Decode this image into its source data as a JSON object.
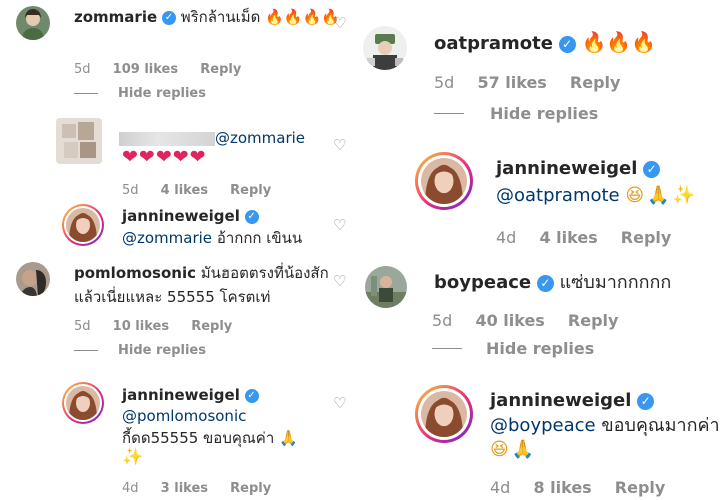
{
  "left": {
    "c1": {
      "user": "zommarie",
      "text": "พริกล้านเม็ด",
      "emoji": "🔥🔥🔥🔥",
      "age": "5d",
      "likes": "109 likes",
      "reply": "Reply",
      "hide": "Hide replies"
    },
    "c2": {
      "mention": "@zommarie",
      "emoji": "❤❤❤❤❤",
      "age": "5d",
      "likes": "4 likes",
      "reply": "Reply"
    },
    "c3": {
      "user": "jannineweigel",
      "mention": "@zommarie",
      "text": "อ้ากกก เขินน"
    },
    "c4": {
      "user": "pomlomosonic",
      "text1": "มันฮอตตรงที่น้องสัก",
      "text2": "แล้วเนี่ยแหละ 55555 โครตเท่",
      "age": "5d",
      "likes": "10 likes",
      "reply": "Reply",
      "hide": "Hide replies"
    },
    "c5": {
      "user": "jannineweigel",
      "mention": "@pomlomosonic",
      "text": "กี้ดด55555 ขอบคุณค่า",
      "emoji1": "🙏",
      "emoji2": "✨",
      "age": "4d",
      "likes": "3 likes",
      "reply": "Reply"
    }
  },
  "right": {
    "c1": {
      "user": "oatpramote",
      "emoji": "🔥🔥🔥",
      "age": "5d",
      "likes": "57 likes",
      "reply": "Reply",
      "hide": "Hide replies"
    },
    "c2": {
      "user": "jannineweigel",
      "mention": "@oatpramote",
      "emoji": "😆🙏✨",
      "age": "4d",
      "likes": "4 likes",
      "reply": "Reply"
    },
    "c3": {
      "user": "boypeace",
      "text": "แซ่บมากกกกก",
      "age": "5d",
      "likes": "40 likes",
      "reply": "Reply",
      "hide": "Hide replies"
    },
    "c4": {
      "user": "jannineweigel",
      "mention": "@boypeace",
      "text": "ขอบคุณมากค่า",
      "emoji": "😆🙏",
      "age": "4d",
      "likes": "8 likes",
      "reply": "Reply"
    }
  },
  "icons": {
    "verified": "verified-badge-icon",
    "like": "heart-outline-icon"
  },
  "colors": {
    "username": "#262626",
    "mention": "#00376b",
    "meta": "#8e8e8e",
    "verified": "#3897f0"
  }
}
